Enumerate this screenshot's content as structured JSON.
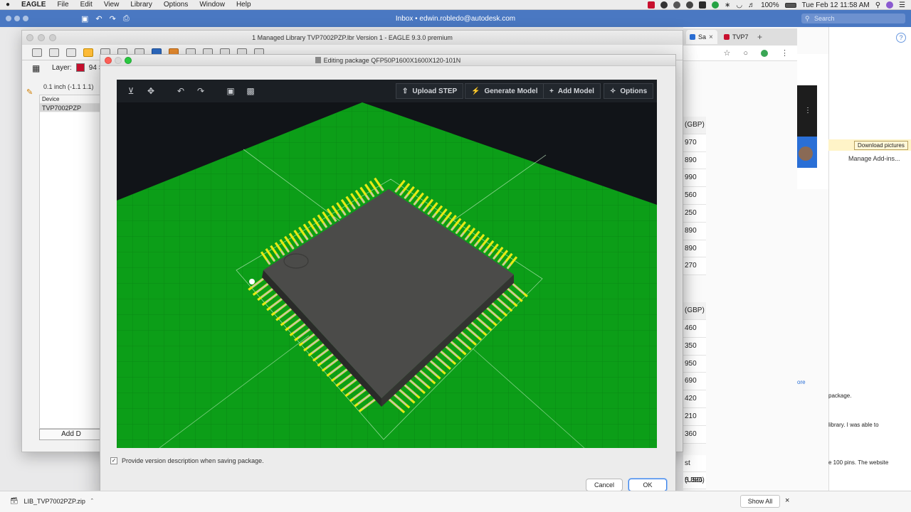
{
  "menubar": {
    "app": "EAGLE",
    "items": [
      "File",
      "Edit",
      "View",
      "Library",
      "Options",
      "Window",
      "Help"
    ],
    "battery": "100%",
    "clock": "Tue Feb 12  11:58 AM"
  },
  "bg_browser": {
    "title": "Inbox • edwin.robledo@autodesk.com",
    "search_placeholder": "Search",
    "tab1": "Sa",
    "tab2": "TVP7",
    "tab_add": "+"
  },
  "eagle": {
    "window_title": "1 Managed Library TVP7002PZP.lbr Version 1 - EAGLE 9.3.0 premium",
    "layer_label": "Layer:",
    "layer_value": "94 S",
    "coords": "0.1 inch (-1.1 1.1)",
    "device_header": "Device",
    "devices": [
      "TVP7002PZP"
    ],
    "add_device": "Add D"
  },
  "dialog": {
    "title": "Editing package QFP50P1600X1600X120-101N",
    "toolbar_buttons": {
      "upload_step": "Upload STEP",
      "generate_model": "Generate Model",
      "add_model": "Add Model",
      "options": "Options"
    },
    "version_checkbox_label": "Provide version description when saving package.",
    "version_checkbox_checked": true,
    "cancel": "Cancel",
    "ok": "OK"
  },
  "price_table": {
    "header1": "(GBP)",
    "values1": [
      "970",
      "890",
      "990",
      "560",
      "250",
      "890",
      "890",
      "270"
    ],
    "header2": "(GBP)",
    "values2": [
      "460",
      "350",
      "950",
      "690",
      "420",
      "210",
      "360"
    ],
    "header3": "st (USD)",
    "values3": [
      "5.386"
    ]
  },
  "outlook": {
    "download_pictures": "Download pictures",
    "manage_addins": "Manage Add-ins...",
    "snippets": [
      "package.",
      "library. I was able to",
      "e 100 pins. The website"
    ],
    "link_snippet": "ore"
  },
  "download_bar": {
    "file": "LIB_TVP7002PZP.zip",
    "show_all": "Show All"
  },
  "colors": {
    "board_green": "#0a9a16",
    "pad_yellow": "#e6ea14",
    "chip_body": "#4b4b49",
    "ok_blue": "#3b82e8"
  }
}
